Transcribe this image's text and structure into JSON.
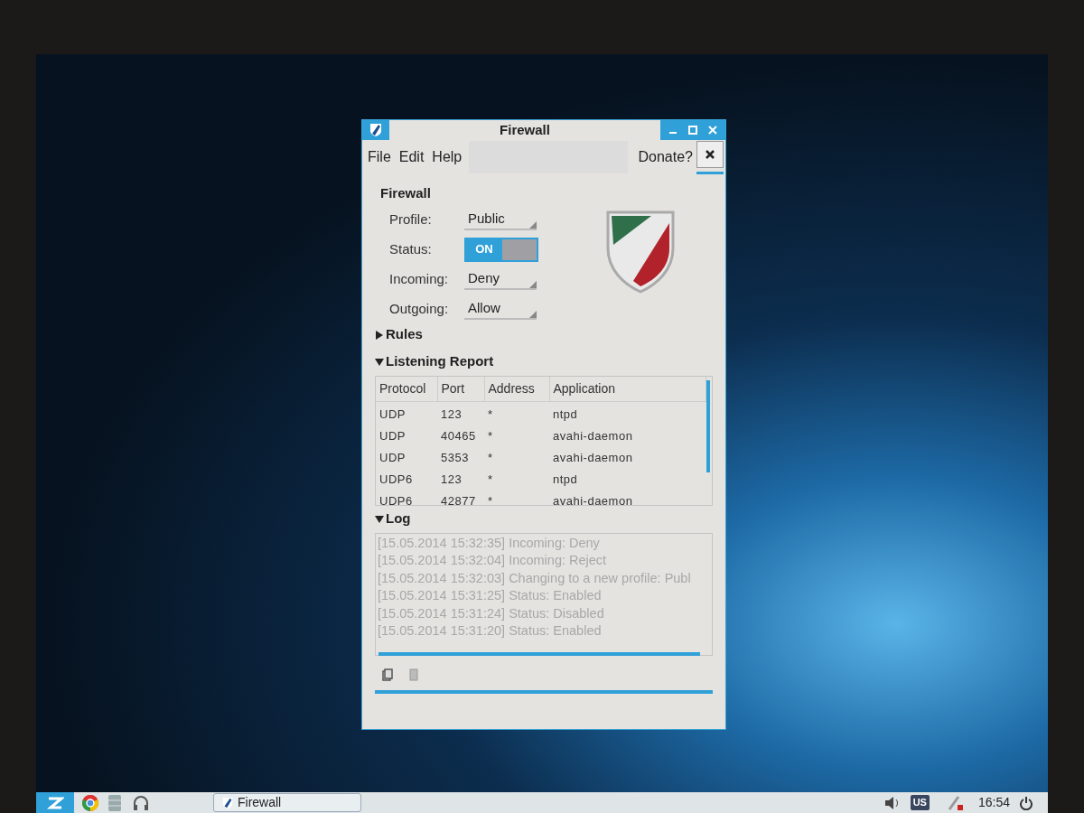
{
  "window": {
    "title": "Firewall"
  },
  "menu": [
    {
      "label": "File"
    },
    {
      "label": "Edit"
    },
    {
      "label": "Help"
    }
  ],
  "donate": {
    "label": "Donate?"
  },
  "firewall": {
    "heading": "Firewall",
    "fields": [
      {
        "kind": "dropdown",
        "label": "Profile:",
        "value": "Public"
      },
      {
        "kind": "switch",
        "label": "Status:",
        "value": "ON",
        "on": true
      },
      {
        "kind": "dropdown",
        "label": "Incoming:",
        "value": "Deny"
      },
      {
        "kind": "dropdown",
        "label": "Outgoing:",
        "value": "Allow"
      }
    ]
  },
  "sections": [
    {
      "title": "Rules",
      "expanded": false
    },
    {
      "title": "Listening Report",
      "expanded": true
    },
    {
      "title": "Log",
      "expanded": true
    }
  ],
  "table": {
    "columns": [
      "Protocol",
      "Port",
      "Address",
      "Application"
    ],
    "rows": [
      [
        "UDP",
        "123",
        "*",
        "ntpd"
      ],
      [
        "UDP",
        "40465",
        "*",
        "avahi-daemon"
      ],
      [
        "UDP",
        "5353",
        "*",
        "avahi-daemon"
      ],
      [
        "UDP6",
        "123",
        "*",
        "ntpd"
      ],
      [
        "UDP6",
        "42877",
        "*",
        "avahi-daemon"
      ]
    ]
  },
  "log": [
    "[15.05.2014 15:32:35] Incoming: Deny",
    "[15.05.2014 15:32:04] Incoming: Reject",
    "[15.05.2014 15:32:03] Changing to a new profile: Publ",
    "[15.05.2014 15:31:25] Status: Enabled",
    "[15.05.2014 15:31:24] Status: Disabled",
    "[15.05.2014 15:31:20] Status: Enabled"
  ],
  "taskbar": {
    "window_button": "Firewall",
    "keyboard_layout": "US",
    "clock": "16:54"
  }
}
